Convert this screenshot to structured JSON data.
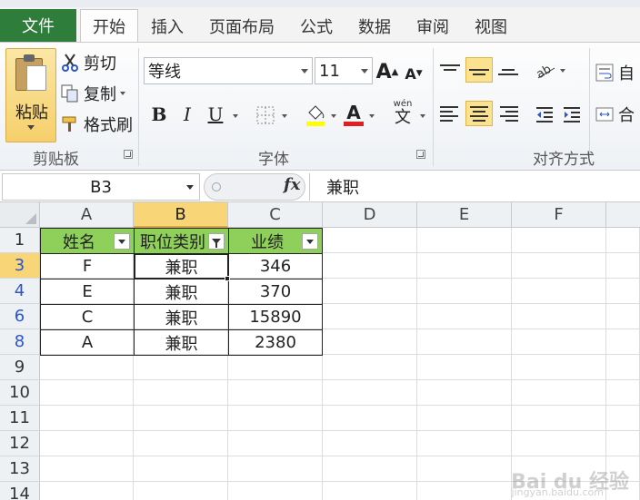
{
  "tabs": {
    "file": "文件",
    "items": [
      "开始",
      "插入",
      "页面布局",
      "公式",
      "数据",
      "审阅",
      "视图"
    ],
    "active": "开始"
  },
  "ribbon": {
    "clipboard": {
      "paste": "粘贴",
      "cut": "剪切",
      "copy": "复制",
      "format_painter": "格式刷",
      "label": "剪贴板"
    },
    "font": {
      "name": "等线",
      "size": "11",
      "grow": "A",
      "shrink": "A",
      "bold": "B",
      "italic": "I",
      "underline": "U",
      "font_color": "A",
      "phonetic": "wén",
      "phonetic_char": "文",
      "label": "字体"
    },
    "alignment": {
      "label": "对齐方式",
      "wrap_text": "自",
      "merge": "合"
    }
  },
  "formula_bar": {
    "name_box": "B3",
    "fx": "fx",
    "value": "兼职"
  },
  "sheet": {
    "columns": [
      "A",
      "B",
      "C",
      "D",
      "E",
      "F"
    ],
    "rows": [
      "1",
      "3",
      "4",
      "6",
      "8",
      "9",
      "10",
      "11",
      "12",
      "13",
      "14"
    ],
    "header_row": [
      "姓名",
      "职位类别",
      "业绩"
    ],
    "data": [
      [
        "F",
        "兼职",
        "346"
      ],
      [
        "E",
        "兼职",
        "370"
      ],
      [
        "C",
        "兼职",
        "15890"
      ],
      [
        "A",
        "兼职",
        "2380"
      ]
    ],
    "header_fill": "#8ed05a",
    "selected_cell": "B3"
  },
  "watermark": {
    "brand": "Bai du 经验",
    "url": "jingyan.baidu.com"
  }
}
